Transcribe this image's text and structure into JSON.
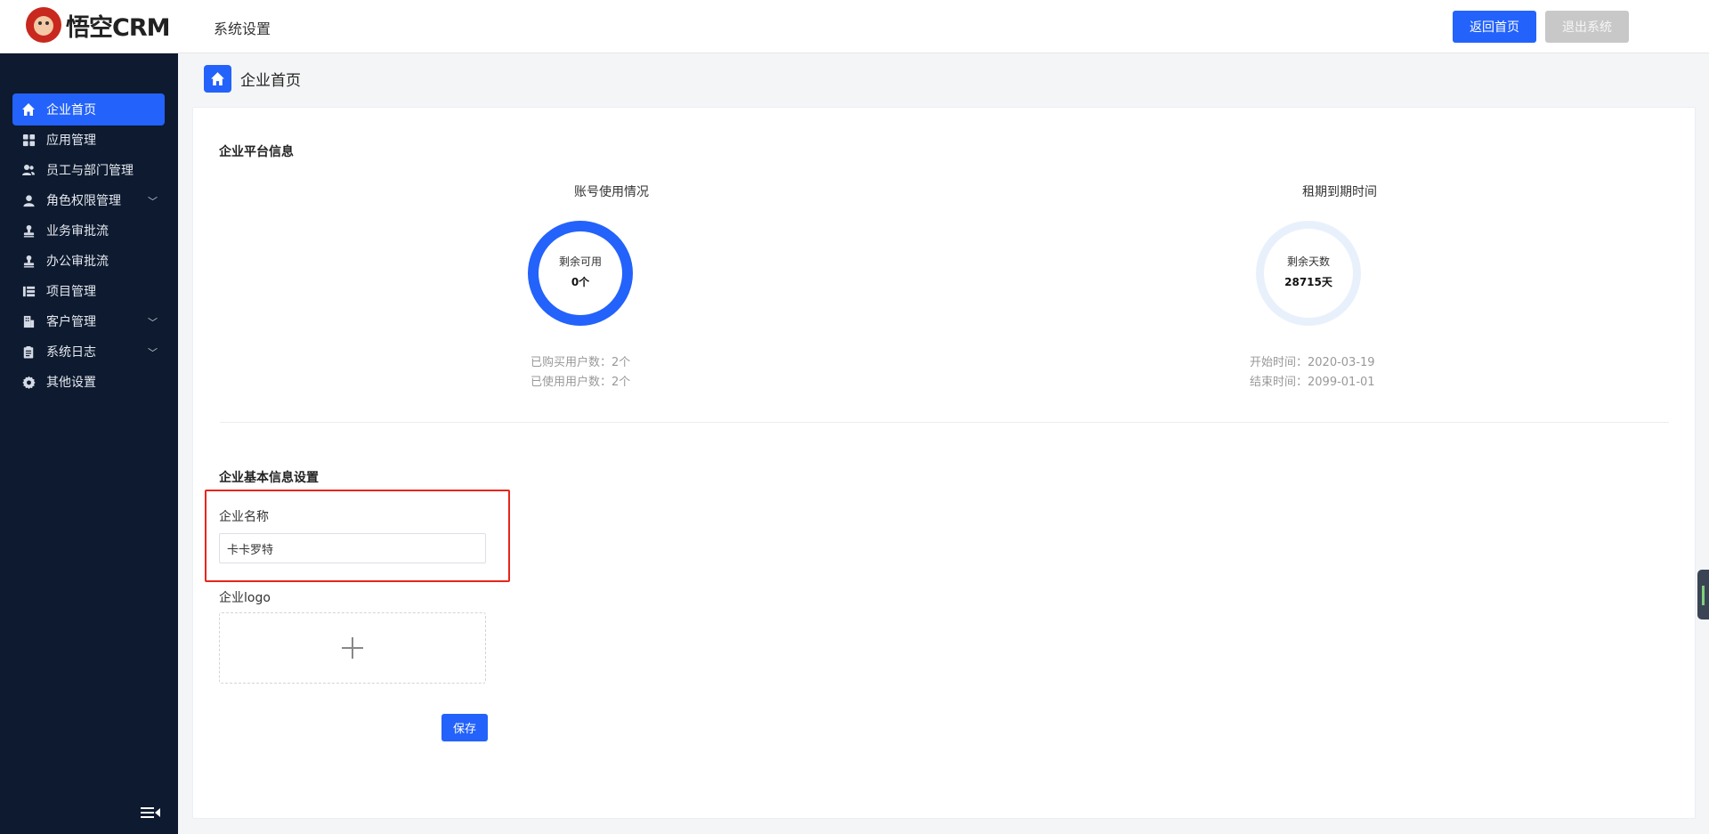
{
  "header": {
    "logo_text": "悟空CRM",
    "title": "系统设置",
    "home_button": "返回首页",
    "logout_button": "退出系统"
  },
  "colors": {
    "primary": "#2362fb",
    "sidebar_bg": "#0d1a2f",
    "highlight": "#e8251c",
    "ring_secondary": "#e8f1fb"
  },
  "sidebar": {
    "items": [
      {
        "label": "企业首页",
        "icon": "home-icon",
        "active": true,
        "has_arrow": false
      },
      {
        "label": "应用管理",
        "icon": "grid-icon",
        "active": false,
        "has_arrow": false
      },
      {
        "label": "员工与部门管理",
        "icon": "users-icon",
        "active": false,
        "has_arrow": false
      },
      {
        "label": "角色权限管理",
        "icon": "user-icon",
        "active": false,
        "has_arrow": true
      },
      {
        "label": "业务审批流",
        "icon": "stamp-icon",
        "active": false,
        "has_arrow": false
      },
      {
        "label": "办公审批流",
        "icon": "stamp-icon",
        "active": false,
        "has_arrow": false
      },
      {
        "label": "项目管理",
        "icon": "list-icon",
        "active": false,
        "has_arrow": false
      },
      {
        "label": "客户管理",
        "icon": "building-icon",
        "active": false,
        "has_arrow": true
      },
      {
        "label": "系统日志",
        "icon": "clipboard-icon",
        "active": false,
        "has_arrow": true
      },
      {
        "label": "其他设置",
        "icon": "gear-icon",
        "active": false,
        "has_arrow": false
      }
    ]
  },
  "page": {
    "title": "企业首页",
    "platform_info_title": "企业平台信息",
    "accounts": {
      "title": "账号使用情况",
      "ring_label": "剩余可用",
      "ring_value": "0个",
      "purchased": "已购买用户数：2个",
      "used": "已使用用户数：2个",
      "usage_fraction": 1.0
    },
    "lease": {
      "title": "租期到期时间",
      "ring_label": "剩余天数",
      "ring_value": "28715天",
      "start": "开始时间：2020-03-19",
      "end": "结束时间：2099-01-01"
    },
    "basic_info_title": "企业基本信息设置",
    "company_name_label": "企业名称",
    "company_name_value": "卡卡罗特",
    "logo_label": "企业logo",
    "save_button": "保存"
  }
}
